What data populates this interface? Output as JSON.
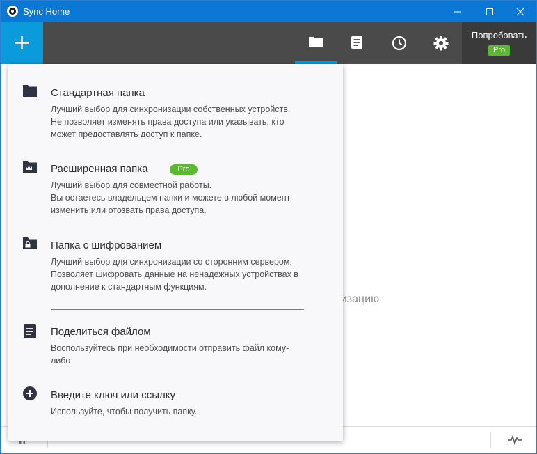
{
  "window": {
    "title": "Sync Home"
  },
  "toolbar": {
    "try_label": "Попробовать",
    "pro_badge": "Pro",
    "tabs": [
      {
        "icon": "folder-icon",
        "active": true
      },
      {
        "icon": "notes-icon",
        "active": false
      },
      {
        "icon": "history-icon",
        "active": false
      },
      {
        "icon": "gear-icon",
        "active": false
      }
    ]
  },
  "background": {
    "partial_text": "низацию"
  },
  "menu": {
    "items": [
      {
        "icon": "folder-icon",
        "title": "Стандартная папка",
        "desc": [
          "Лучший выбор для синхронизации собственных устройств.",
          "Не позволяет изменять права доступа или указывать, кто",
          "может предоставлять доступ к папке."
        ]
      },
      {
        "icon": "crown-folder-icon",
        "title": "Расширенная папка",
        "badge": "Pro",
        "desc": [
          "Лучший выбор для совместной работы.",
          "Вы остаетесь владельцем папки и можете в любой момент",
          "изменить или отозвать права доступа."
        ]
      },
      {
        "icon": "lock-folder-icon",
        "title": "Папка с шифрованием",
        "desc": [
          "Лучший выбор для синхронизации со сторонним сервером.",
          "Позволяет шифровать данные на ненадежных устройствах в",
          "дополнение к стандартным функциям."
        ]
      },
      {
        "icon": "file-icon",
        "title": "Поделиться файлом",
        "desc": [
          "Воспользуйтесь при необходимости отправить файл кому-",
          "либо"
        ]
      },
      {
        "icon": "plus-circle-icon",
        "title": "Введите ключ или ссылку",
        "desc": [
          "Используйте, чтобы получить папку."
        ]
      }
    ]
  },
  "colors": {
    "titlebar": "#0c78d6",
    "toolbar": "#4a4a4a",
    "accent": "#0a9bdc",
    "pro_green": "#5cb82e"
  }
}
